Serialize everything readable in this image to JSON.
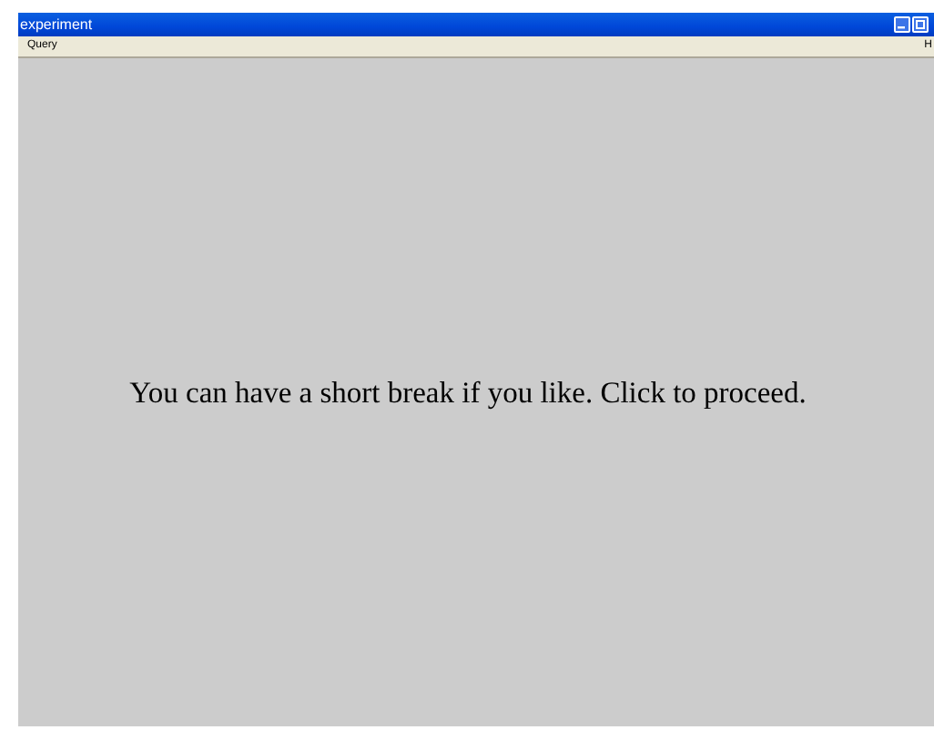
{
  "window": {
    "title": "experiment"
  },
  "menu": [
    {
      "label": "Query"
    },
    {
      "label": "H"
    }
  ],
  "content": {
    "message": "You can have a short break if you like. Click to proceed."
  }
}
